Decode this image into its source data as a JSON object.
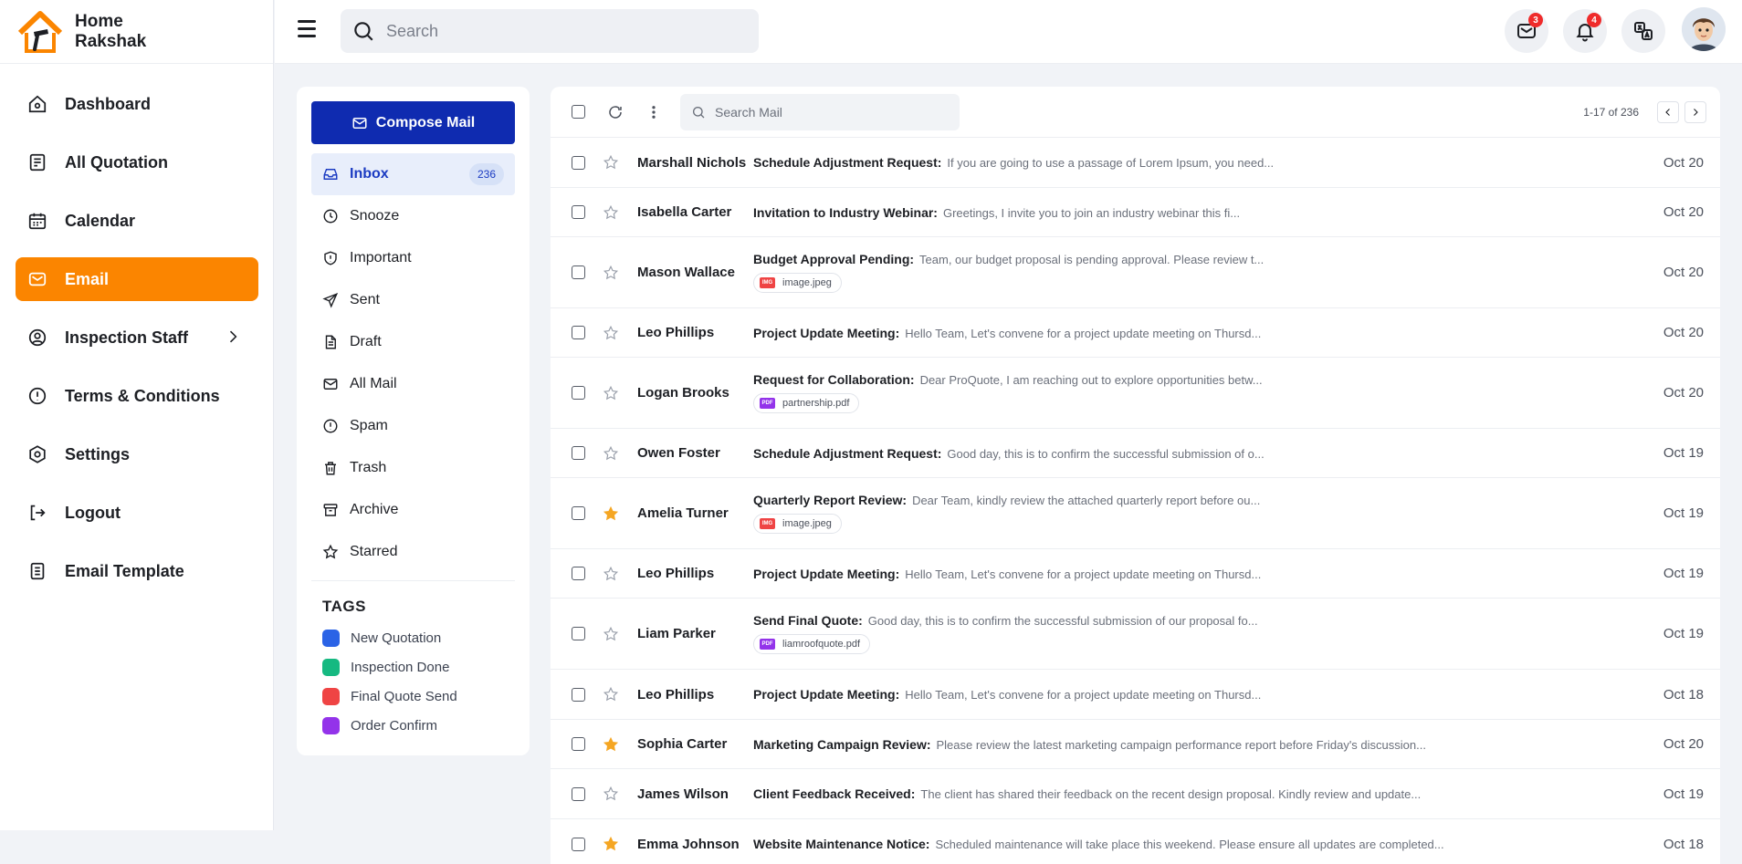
{
  "brand": {
    "name": "Home Rakshak"
  },
  "sidebar": {
    "items": [
      {
        "label": "Dashboard",
        "icon": "home-icon"
      },
      {
        "label": "All Quotation",
        "icon": "quotation-icon"
      },
      {
        "label": "Calendar",
        "icon": "calendar-icon"
      },
      {
        "label": "Email",
        "icon": "email-icon",
        "active": true
      },
      {
        "label": "Inspection Staff",
        "icon": "staff-icon"
      },
      {
        "label": "Terms & Conditions",
        "icon": "alert-circle-icon"
      },
      {
        "label": "Settings",
        "icon": "settings-icon"
      },
      {
        "label": "Logout",
        "icon": "logout-icon"
      },
      {
        "label": "Email Template",
        "icon": "template-icon"
      }
    ]
  },
  "header": {
    "search_placeholder": "Search",
    "mail_badge": "3",
    "notification_badge": "4"
  },
  "mailnav": {
    "compose_label": "Compose Mail",
    "folders": [
      {
        "label": "Inbox",
        "count": "236"
      },
      {
        "label": "Snooze"
      },
      {
        "label": "Important"
      },
      {
        "label": "Sent"
      },
      {
        "label": "Draft"
      },
      {
        "label": "All Mail"
      },
      {
        "label": "Spam"
      },
      {
        "label": "Trash"
      },
      {
        "label": "Archive"
      },
      {
        "label": "Starred"
      }
    ],
    "tags_title": "TAGS",
    "tags": [
      {
        "label": "New Quotation",
        "color": "#2b63e6"
      },
      {
        "label": "Inspection Done",
        "color": "#16b981"
      },
      {
        "label": "Final Quote Send",
        "color": "#ef4444"
      },
      {
        "label": "Order Confirm",
        "color": "#9333ea"
      }
    ]
  },
  "maillist": {
    "search_placeholder": "Search Mail",
    "pagination": "1-17 of 236",
    "rows": [
      {
        "sender": "Marshall Nichols",
        "subject": "Schedule Adjustment Request:",
        "preview": "If you are going to use a passage of Lorem Ipsum, you need...",
        "date": "Oct 20",
        "starred": false
      },
      {
        "sender": "Isabella Carter",
        "subject": "Invitation to Industry Webinar:",
        "preview": "Greetings, I invite you to join an industry webinar this fi...",
        "date": "Oct 20",
        "starred": false
      },
      {
        "sender": "Mason Wallace",
        "subject": "Budget Approval Pending:",
        "preview": "Team, our budget proposal is pending approval. Please review t...",
        "date": "Oct 20",
        "starred": false,
        "attachment": {
          "type": "IMG",
          "name": "image.jpeg",
          "color": "#ef4444"
        }
      },
      {
        "sender": "Leo Phillips",
        "subject": "Project Update Meeting:",
        "preview": "Hello Team, Let's convene for a project update meeting on Thursd...",
        "date": "Oct 20",
        "starred": false
      },
      {
        "sender": "Logan Brooks",
        "subject": "Request for Collaboration:",
        "preview": "Dear ProQuote, I am reaching out to explore opportunities betw...",
        "date": "Oct 20",
        "starred": false,
        "attachment": {
          "type": "PDF",
          "name": "partnership.pdf",
          "color": "#9333ea"
        }
      },
      {
        "sender": "Owen Foster",
        "subject": "Schedule Adjustment Request:",
        "preview": "Good day, this is to confirm the successful submission of o...",
        "date": "Oct 19",
        "starred": false
      },
      {
        "sender": "Amelia Turner",
        "subject": "Quarterly Report Review:",
        "preview": "Dear Team, kindly review the attached quarterly report before ou...",
        "date": "Oct 19",
        "starred": true,
        "attachment": {
          "type": "IMG",
          "name": "image.jpeg",
          "color": "#ef4444"
        }
      },
      {
        "sender": "Leo Phillips",
        "subject": "Project Update Meeting:",
        "preview": "Hello Team, Let's convene for a project update meeting on Thursd...",
        "date": "Oct 19",
        "starred": false
      },
      {
        "sender": "Liam Parker",
        "subject": "Send Final Quote:",
        "preview": "Good day, this is to confirm the successful submission of our proposal fo...",
        "date": "Oct 19",
        "starred": false,
        "attachment": {
          "type": "PDF",
          "name": "liamroofquote.pdf",
          "color": "#9333ea"
        }
      },
      {
        "sender": "Leo Phillips",
        "subject": "Project Update Meeting:",
        "preview": "Hello Team, Let's convene for a project update meeting on Thursd...",
        "date": "Oct 18",
        "starred": false
      },
      {
        "sender": "Sophia Carter",
        "subject": "Marketing Campaign Review:",
        "preview": "Please review the latest marketing campaign performance report before Friday's discussion...",
        "date": "Oct 20",
        "starred": true
      },
      {
        "sender": "James Wilson",
        "subject": "Client Feedback Received:",
        "preview": "The client has shared their feedback on the recent design proposal. Kindly review and update...",
        "date": "Oct 19",
        "starred": false
      },
      {
        "sender": "Emma Johnson",
        "subject": "Website Maintenance Notice:",
        "preview": "Scheduled maintenance will take place this weekend. Please ensure all updates are completed...",
        "date": "Oct 18",
        "starred": true
      }
    ]
  }
}
